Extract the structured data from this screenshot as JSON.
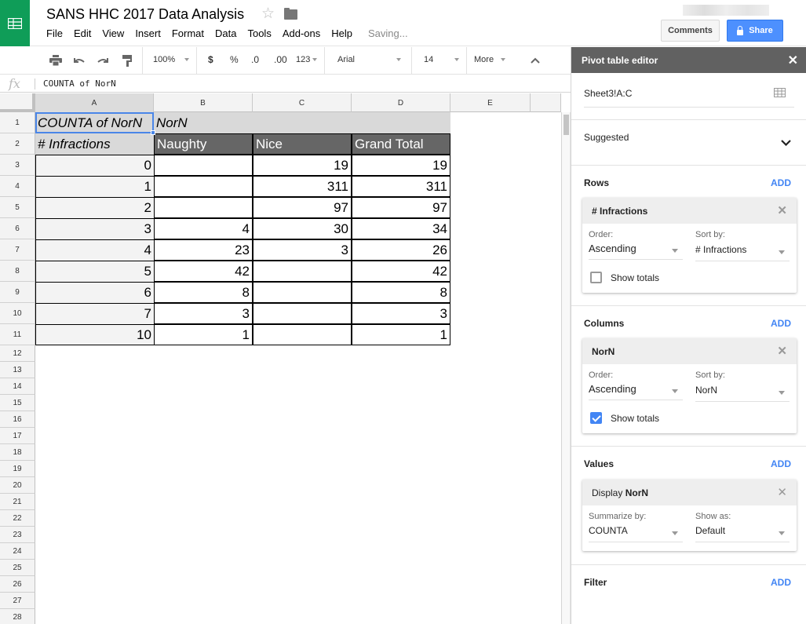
{
  "header": {
    "title": "SANS HHC 2017 Data Analysis",
    "status": "Saving...",
    "menus": [
      "File",
      "Edit",
      "View",
      "Insert",
      "Format",
      "Data",
      "Tools",
      "Add-ons",
      "Help"
    ],
    "comments_label": "Comments",
    "share_label": "Share",
    "icons": {
      "logo": "sheets-logo-icon",
      "star": "star-icon",
      "folder": "folder-icon",
      "lock": "lock-icon"
    }
  },
  "toolbar": {
    "zoom": "100%",
    "currency": "$",
    "percent": "%",
    "decrease_decimal": ".0",
    "increase_decimal": ".00",
    "number_format": "123",
    "font": "Arial",
    "font_size": "14",
    "more": "More",
    "icons": [
      "print-icon",
      "undo-icon",
      "redo-icon",
      "paint-format-icon",
      "collapse-icon"
    ]
  },
  "formula_bar": {
    "fx": "fx",
    "content": "COUNTA of NorN"
  },
  "grid": {
    "columns": [
      "A",
      "B",
      "C",
      "D",
      "E",
      ""
    ],
    "selected_cell": "A1",
    "row_numbers": [
      "1",
      "2",
      "3",
      "4",
      "5",
      "6",
      "7",
      "8",
      "9",
      "10",
      "11",
      "12",
      "13",
      "14",
      "15",
      "16",
      "17",
      "18",
      "19",
      "20",
      "21",
      "22",
      "23",
      "24",
      "25",
      "26",
      "27",
      "28"
    ],
    "row1": {
      "a": "COUNTA of NorN",
      "b": "NorN"
    },
    "row2": {
      "a": "# Infractions",
      "b": "Naughty",
      "c": "Nice",
      "d": "Grand Total"
    },
    "body": [
      {
        "a": "0",
        "b": "",
        "c": "19",
        "d": "19"
      },
      {
        "a": "1",
        "b": "",
        "c": "311",
        "d": "311"
      },
      {
        "a": "2",
        "b": "",
        "c": "97",
        "d": "97"
      },
      {
        "a": "3",
        "b": "4",
        "c": "30",
        "d": "34"
      },
      {
        "a": "4",
        "b": "23",
        "c": "3",
        "d": "26"
      },
      {
        "a": "5",
        "b": "42",
        "c": "",
        "d": "42"
      },
      {
        "a": "6",
        "b": "8",
        "c": "",
        "d": "8"
      },
      {
        "a": "7",
        "b": "3",
        "c": "",
        "d": "3"
      },
      {
        "a": "10",
        "b": "1",
        "c": "",
        "d": "1"
      }
    ]
  },
  "panel": {
    "title": "Pivot table editor",
    "range": "Sheet3!A:C",
    "suggested": "Suggested",
    "add_label": "ADD",
    "rows": {
      "title": "Rows",
      "field": "# Infractions",
      "order_label": "Order:",
      "order_value": "Ascending",
      "sort_label": "Sort by:",
      "sort_value": "# Infractions",
      "show_totals_label": "Show totals",
      "show_totals": false
    },
    "columns": {
      "title": "Columns",
      "field": "NorN",
      "order_label": "Order:",
      "order_value": "Ascending",
      "sort_label": "Sort by:",
      "sort_value": "NorN",
      "show_totals_label": "Show totals",
      "show_totals": true
    },
    "values": {
      "title": "Values",
      "field_prefix": "Display",
      "field": "NorN",
      "summarize_label": "Summarize by:",
      "summarize_value": "COUNTA",
      "show_as_label": "Show as:",
      "show_as_value": "Default"
    },
    "filter": {
      "title": "Filter"
    }
  },
  "colors": {
    "brand_green": "#0f9d58",
    "share_blue": "#4d90fe",
    "accent_blue": "#4285f4",
    "pivot_header_dark": "#666666",
    "pivot_header_gray": "#d9d9d9",
    "panel_header": "#616161"
  }
}
